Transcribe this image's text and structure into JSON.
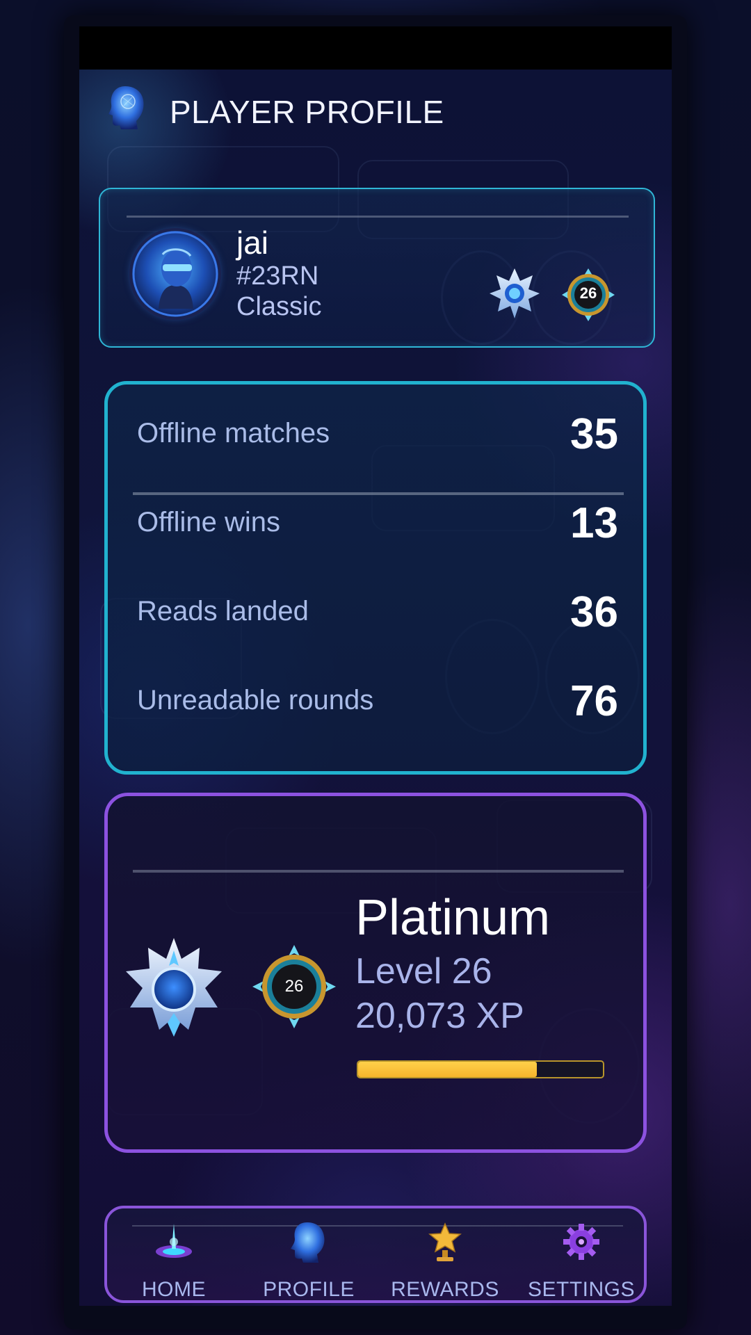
{
  "header": {
    "title": "PLAYER PROFILE",
    "icon": "head-icon"
  },
  "player": {
    "name": "jai",
    "tag": "#23RN",
    "mode": "Classic",
    "level_badge": "26"
  },
  "stats": [
    {
      "label": "Offline matches",
      "value": "35"
    },
    {
      "label": "Offline wins",
      "value": "13"
    },
    {
      "label": "Reads landed",
      "value": "36"
    },
    {
      "label": "Unreadable rounds",
      "value": "76"
    }
  ],
  "rank": {
    "tier": "Platinum",
    "level": "Level 26",
    "xp": "20,073 XP",
    "level_badge": "26",
    "xp_progress": 0.73
  },
  "nav": {
    "items": [
      {
        "label": "HOME",
        "icon": "portal-icon"
      },
      {
        "label": "PROFILE",
        "icon": "head-icon"
      },
      {
        "label": "REWARDS",
        "icon": "trophy-icon"
      },
      {
        "label": "SETTINGS",
        "icon": "gear-icon"
      }
    ]
  },
  "colors": {
    "accent_cyan": "#21b2cf",
    "accent_purple": "#8c52e0",
    "xp_gold": "#f6b52c",
    "text_muted": "#a9b4ea"
  }
}
